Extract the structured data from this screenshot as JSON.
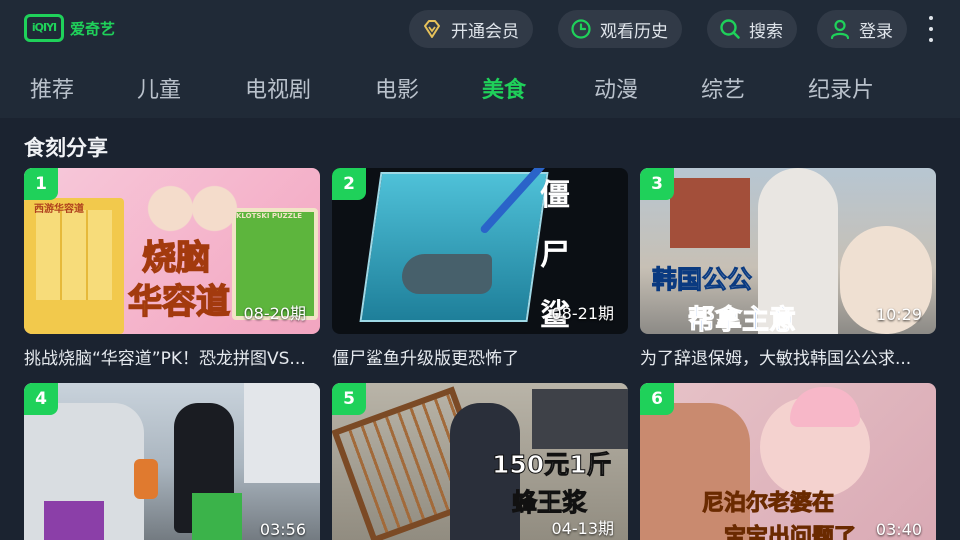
{
  "header": {
    "logo_mark": "iQIYI",
    "logo_text": "爱奇艺",
    "vip_label": "开通会员",
    "history_label": "观看历史",
    "search_label": "搜索",
    "login_label": "登录"
  },
  "tabs": [
    {
      "label": "推荐"
    },
    {
      "label": "儿童"
    },
    {
      "label": "电视剧"
    },
    {
      "label": "电影"
    },
    {
      "label": "美食"
    },
    {
      "label": "动漫"
    },
    {
      "label": "综艺"
    },
    {
      "label": "纪录片"
    }
  ],
  "active_tab": "美食",
  "section": {
    "title": "食刻分享",
    "cards": [
      {
        "rank": "1",
        "stamp": "08-20期",
        "title": "挑战烧脑“华容道”PK！恐龙拼图VS...",
        "overlay": [
          "烧脑",
          "华容道"
        ],
        "small_text": [
          "西游华容道",
          "KLOTSKI PUZZLE"
        ]
      },
      {
        "rank": "2",
        "stamp": "08-21期",
        "title": "僵尸鲨鱼升级版更恐怖了",
        "overlay": [
          "僵",
          "尸",
          "鲨"
        ]
      },
      {
        "rank": "3",
        "stamp": "10:29",
        "title": "为了辞退保姆，大敏找韩国公公求...",
        "overlay": [
          "韩国公公",
          "帮拿主意"
        ]
      },
      {
        "rank": "4",
        "stamp": "03:56",
        "title": ""
      },
      {
        "rank": "5",
        "stamp": "04-13期",
        "title": "",
        "overlay": [
          "150元1斤",
          "蜂王浆"
        ]
      },
      {
        "rank": "6",
        "stamp": "03:40",
        "title": "",
        "overlay": [
          "尼泊尔老婆在",
          "宝宝出问题了"
        ]
      }
    ]
  },
  "colors": {
    "accent": "#1fd15a",
    "background": "#1b2330",
    "bar": "#202a37",
    "pill": "#313a47"
  }
}
